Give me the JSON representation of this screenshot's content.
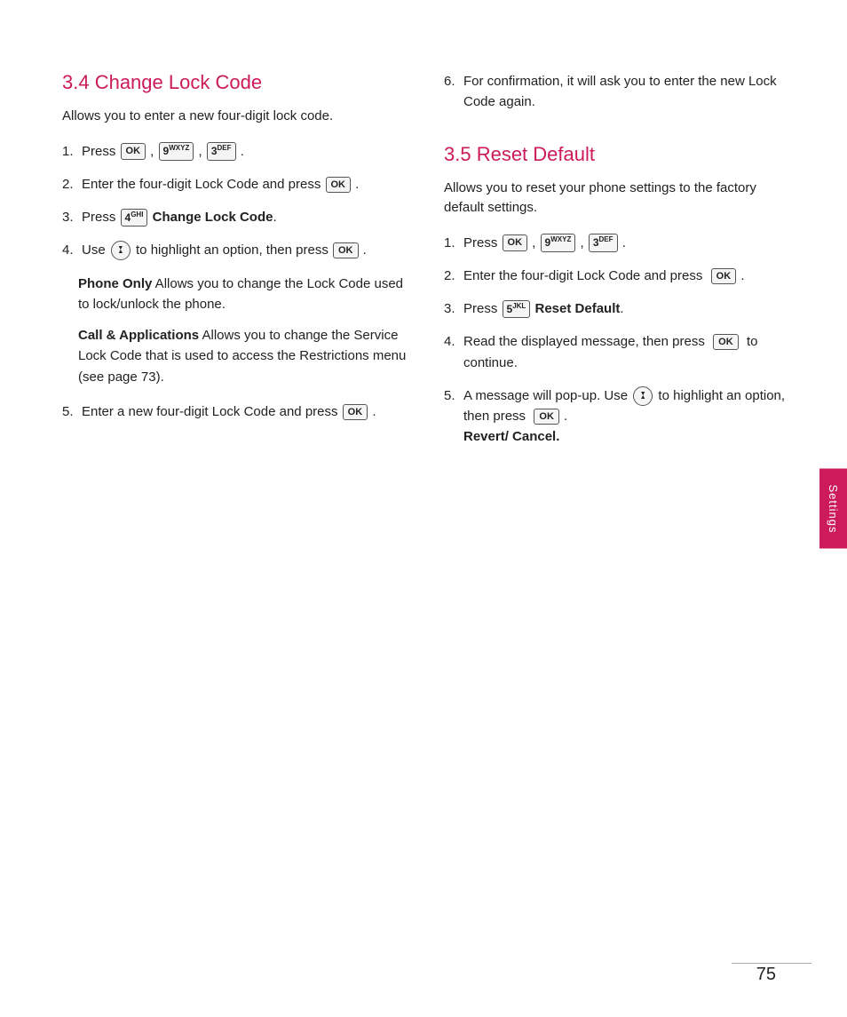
{
  "page": {
    "number": "75",
    "sidebar_label": "Settings"
  },
  "left": {
    "section_id": "3.4",
    "section_title": "3.4 Change Lock Code",
    "section_desc": "Allows you to enter a new four-digit lock code.",
    "steps": [
      {
        "num": "1.",
        "text": "Press",
        "keys": [
          "OK",
          "9wxyz",
          "3DEF"
        ],
        "suffix": "."
      },
      {
        "num": "2.",
        "text": "Enter the four-digit Lock Code and press",
        "key_end": "OK",
        "suffix": "."
      },
      {
        "num": "3.",
        "text": "Press",
        "key": "4GHI",
        "bold": "Change Lock Code",
        "suffix": "."
      },
      {
        "num": "4.",
        "text_before": "Use",
        "nav_icon": true,
        "text_after": "to highlight an option, then press",
        "key_end": "OK",
        "suffix": ".",
        "sub_items": [
          {
            "term": "Phone Only",
            "desc": "Allows you to change the Lock Code used to lock/unlock the phone."
          },
          {
            "term": "Call & Applications",
            "desc": "Allows you to change the Service Lock Code that is used to access the Restrictions menu (see page 73)."
          }
        ]
      },
      {
        "num": "5.",
        "text": "Enter a new four-digit Lock Code and press",
        "key_end": "OK",
        "suffix": "."
      }
    ]
  },
  "right": {
    "step6": {
      "num": "6.",
      "text": "For confirmation, it will ask you to enter the new Lock Code again."
    },
    "section_id": "3.5",
    "section_title": "3.5 Reset Default",
    "section_desc": "Allows you to reset your phone settings to the factory default settings.",
    "steps": [
      {
        "num": "1.",
        "text": "Press",
        "keys": [
          "OK",
          "9wxyz",
          "3DEF"
        ],
        "suffix": "."
      },
      {
        "num": "2.",
        "text": "Enter the four-digit Lock Code and press",
        "key_end": "OK",
        "suffix": "."
      },
      {
        "num": "3.",
        "text": "Press",
        "key": "5JKL",
        "bold": "Reset Default",
        "suffix": "."
      },
      {
        "num": "4.",
        "text": "Read the displayed message, then press",
        "key_end": "OK",
        "text2": "to continue.",
        "suffix": ""
      },
      {
        "num": "5.",
        "text_before": "A message will pop-up. Use",
        "nav_icon": true,
        "text_after": "to highlight an option, then press",
        "key_end": "OK",
        "suffix": ".",
        "sub_items": [
          {
            "bold_only": "Revert/ Cancel."
          }
        ]
      }
    ]
  }
}
